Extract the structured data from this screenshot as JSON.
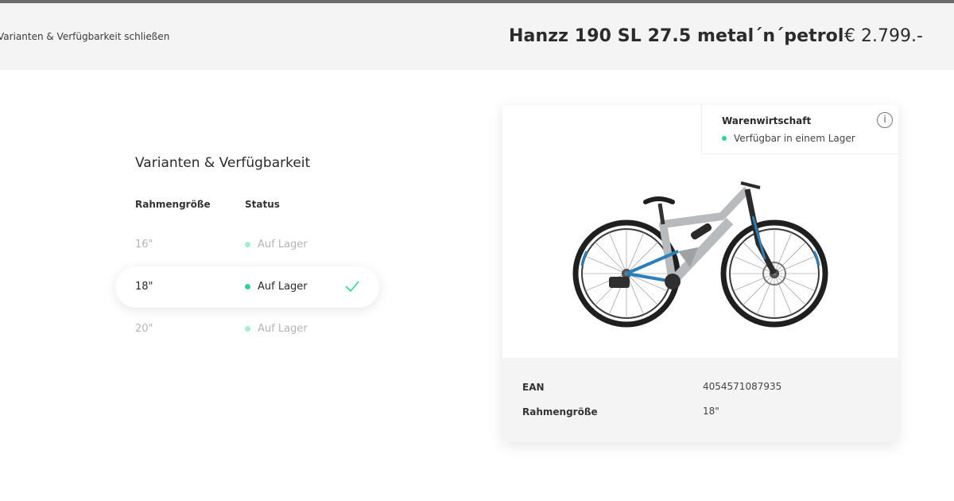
{
  "header": {
    "close_label": "Varianten & Verfügbarkeit schließen",
    "product_title": "Hanzz 190 SL 27.5 metal´n´petrol",
    "price": "€ 2.799.-"
  },
  "variants": {
    "title": "Varianten & Verfügbarkeit",
    "columns": {
      "size": "Rahmengröße",
      "status": "Status"
    },
    "rows": [
      {
        "size": "16\"",
        "status": "Auf Lager",
        "selected": false
      },
      {
        "size": "18\"",
        "status": "Auf Lager",
        "selected": true
      },
      {
        "size": "20\"",
        "status": "Auf Lager",
        "selected": false
      }
    ]
  },
  "card": {
    "stock": {
      "title": "Warenwirtschaft",
      "status": "Verfügbar in einem Lager",
      "info_icon": "i"
    },
    "details": [
      {
        "label": "EAN",
        "value": "4054571087935"
      },
      {
        "label": "Rahmengröße",
        "value": "18\""
      }
    ]
  },
  "colors": {
    "accent": "#2ed3a0",
    "header_bg": "#f4f4f4",
    "bike_frame": "#b8bbbd",
    "bike_blue": "#2c7fb8"
  },
  "icons": {
    "check": "check-icon",
    "info": "info-icon",
    "product_image": "mountain-bike-image"
  }
}
